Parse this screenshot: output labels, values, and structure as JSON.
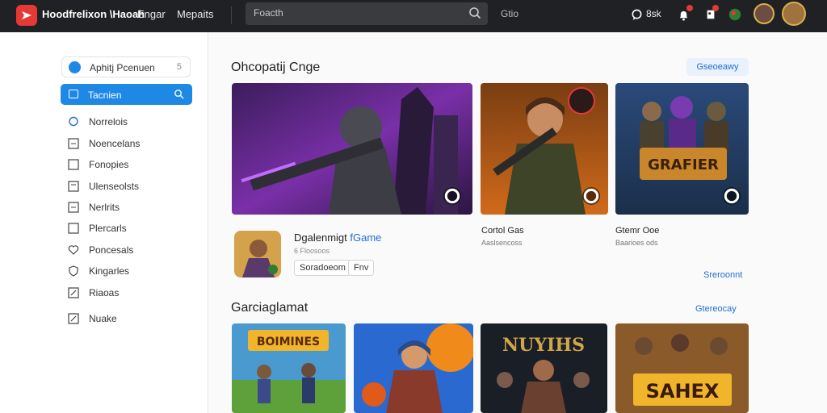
{
  "topbar": {
    "brand": "Hoodfrelixon \\Haoah",
    "nav": [
      "Engar",
      "Mepaits"
    ],
    "search_text": "Foacth",
    "extra": "Gtio",
    "count": "8sk"
  },
  "sidebar": {
    "top_item": {
      "label": "Aphitj Pcenuen",
      "num": "5"
    },
    "active_item": {
      "label": "Tacnien"
    },
    "items": [
      {
        "label": "Norrelois",
        "icon": "chat-icon"
      },
      {
        "label": "Noencelans",
        "icon": "grid-icon"
      },
      {
        "label": "Fonopies",
        "icon": "square-icon"
      },
      {
        "label": "Ulenseolsts",
        "icon": "square-icon"
      },
      {
        "label": "Nerlrits",
        "icon": "grid-icon"
      },
      {
        "label": "Plercarls",
        "icon": "square-icon"
      },
      {
        "label": "Poncesals",
        "icon": "heart-icon"
      },
      {
        "label": "Kingarles",
        "icon": "shield-icon"
      },
      {
        "label": "Riaoas",
        "icon": "edit-icon"
      },
      {
        "label": "Nuake",
        "icon": "edit-icon"
      }
    ]
  },
  "section1": {
    "title": "Ohcopatij Cnge",
    "button": "Gseoeawy",
    "cards": [
      {
        "name": "Cortol Gas",
        "sub": "Aaslsencoss"
      },
      {
        "name": "Gtemr Ooe",
        "sub": "Baarioes ods"
      }
    ],
    "featured": {
      "title": "Dgalenmigt ",
      "title_accent": "fGame",
      "sub": "6 Floosoos",
      "chips": [
        "Soradoeom",
        "Fnv"
      ]
    },
    "link": "Sreroonnt"
  },
  "section2": {
    "title": "Garciaglamat",
    "link": "Gtereocay",
    "banners": [
      "BOIMINES",
      "NUYIHS",
      "SAHEX"
    ]
  },
  "colors": {
    "accent": "#1e88e5",
    "topbar": "#202124",
    "brand_red": "#e53935"
  }
}
